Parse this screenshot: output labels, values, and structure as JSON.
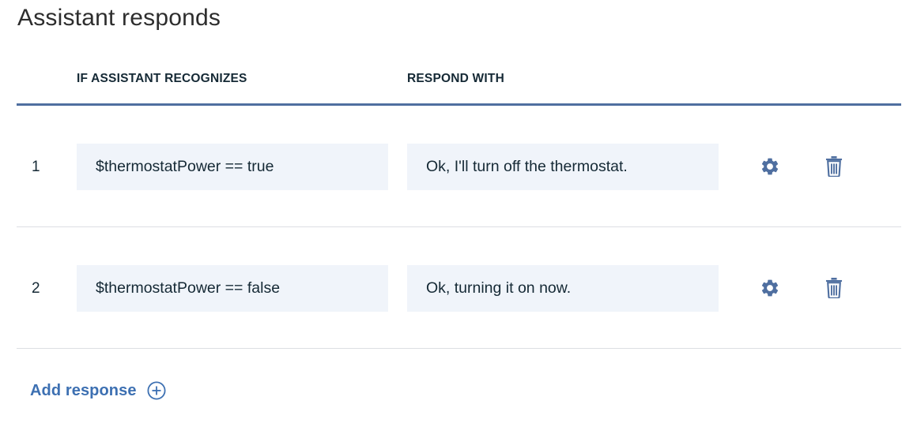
{
  "section": {
    "title": "Assistant responds"
  },
  "table": {
    "headers": {
      "condition": "IF ASSISTANT RECOGNIZES",
      "response": "RESPOND WITH"
    },
    "rows": [
      {
        "number": "1",
        "condition": "$thermostatPower == true",
        "response": "Ok, I'll turn off the thermostat."
      },
      {
        "number": "2",
        "condition": "$thermostatPower == false",
        "response": "Ok, turning it on now."
      }
    ]
  },
  "actions": {
    "add_response_label": "Add response",
    "row_settings_icon": "gear-icon",
    "row_delete_icon": "trash-icon",
    "add_icon": "plus-circle-icon"
  },
  "colors": {
    "accent": "#3d70b2",
    "icon": "#4f6fa0",
    "field_background": "#f0f4fa",
    "divider": "#dcdfe3",
    "text": "#152935"
  }
}
